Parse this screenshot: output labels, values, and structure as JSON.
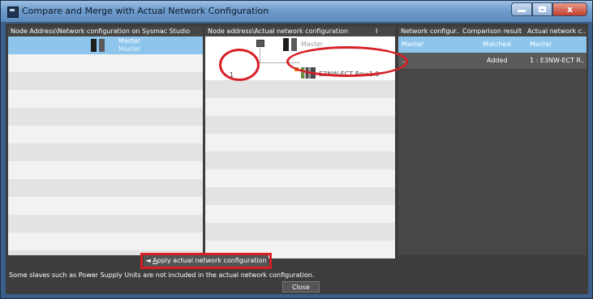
{
  "window": {
    "title": "Compare and Merge with Actual Network Configuration",
    "close_glyph": "x"
  },
  "left_panel": {
    "header": "Node Address\\Network configuration on Sysmac Studio",
    "master_line1": "Master",
    "master_line2": "Master"
  },
  "middle_panel": {
    "header": "Node address\\Actual network configuration",
    "header_marker": "I",
    "master_label": "Master",
    "node_number": "1",
    "slave_label": "E3NW-ECT Rev:1.0"
  },
  "right_panel": {
    "columns": [
      "Network configur...",
      "Comparison result",
      "Actual network c..."
    ],
    "rows": [
      [
        "Master",
        "Matched",
        "Master"
      ],
      [
        "...",
        "Added",
        "1 : E3NW-ECT R..."
      ]
    ]
  },
  "footer": {
    "apply_arrow": "◄",
    "apply_label_underlined": "A",
    "apply_label_rest": "pply actual network configuration",
    "note": "Some slaves such as Power Supply Units are not included in the actual network configuration.",
    "close_label": "Close"
  },
  "colors": {
    "highlight": "#d81f26",
    "selection": "#8ec5ec"
  }
}
